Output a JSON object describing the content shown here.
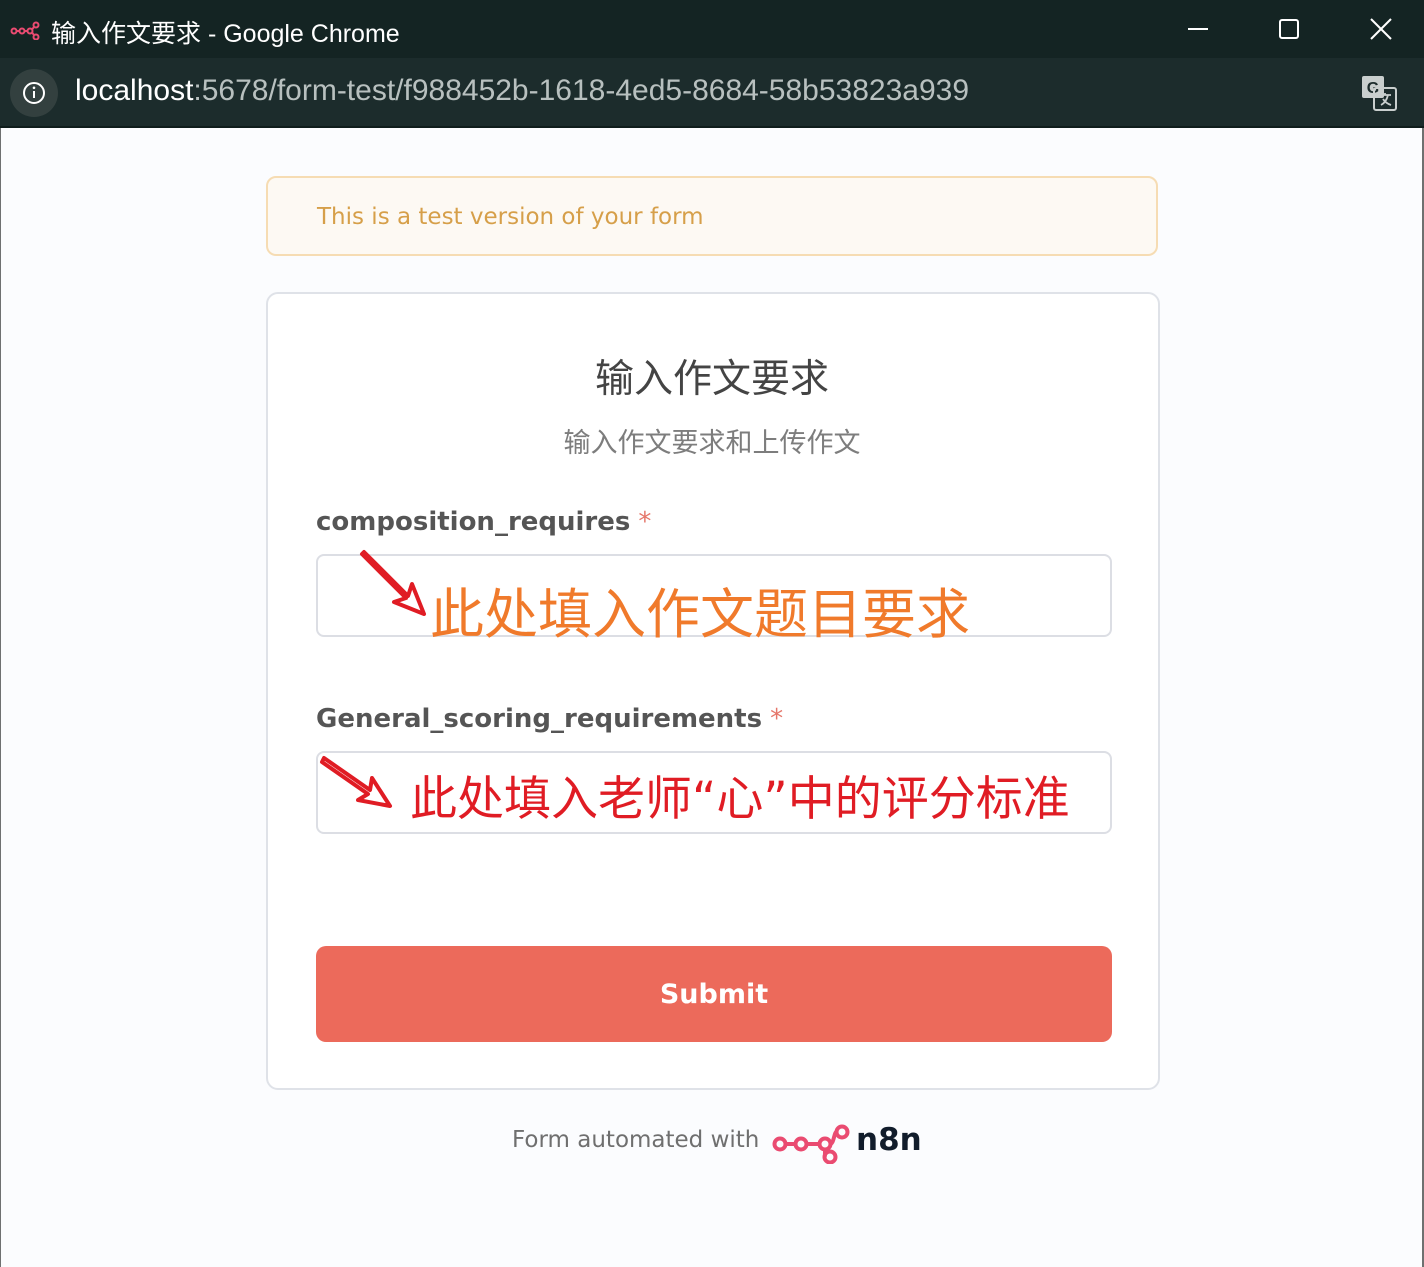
{
  "window": {
    "title": "输入作文要求 - Google Chrome"
  },
  "addressbar": {
    "url_host": "localhost",
    "url_rest": ":5678/form-test/f988452b-1618-4ed5-8684-58b53823a939"
  },
  "banner": {
    "text": "This is a test version of your form"
  },
  "form": {
    "title": "输入作文要求",
    "subtitle": "输入作文要求和上传作文",
    "fields": [
      {
        "label": "composition_requires",
        "required_mark": "*",
        "value": "",
        "annotation": "此处填入作文题目要求"
      },
      {
        "label": "General_scoring_requirements",
        "required_mark": "*",
        "value": "",
        "annotation": "此处填入老师“心”中的评分标准"
      }
    ],
    "submit_label": "Submit"
  },
  "footer": {
    "text": "Form automated with",
    "brand": "n8n"
  },
  "colors": {
    "submit": "#ec6a5b",
    "brand": "#ea4b71",
    "banner_text": "#d69f49",
    "annotation_orange": "#f07a2b",
    "annotation_red": "#e01c24"
  },
  "icons": [
    "n8n-app-icon",
    "minimize-icon",
    "maximize-icon",
    "close-icon",
    "info-icon",
    "translate-icon",
    "arrow-icon",
    "n8n-logo-icon"
  ]
}
